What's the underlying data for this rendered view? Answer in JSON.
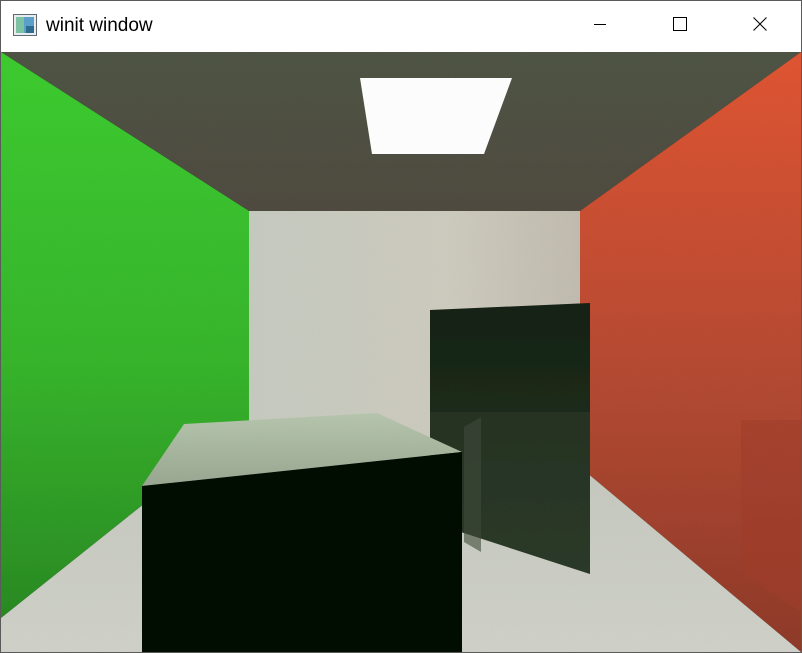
{
  "window": {
    "title": "winit window",
    "app_icon": "winit-app-icon",
    "controls": {
      "minimize_icon": "minimize-icon",
      "maximize_icon": "maximize-icon",
      "close_icon": "close-icon"
    }
  },
  "scene": {
    "description_name": "cornell-box-render",
    "colors": {
      "left_wall": "#36b52c",
      "right_wall": "#c9492a",
      "back_wall": "#c9c9bf",
      "ceiling": "#55564a",
      "floor": "#c8cac2",
      "light": "#ffffff",
      "short_box_front": "#050805",
      "short_box_top": "#a8b7a0",
      "tall_box": "#1d2a1a"
    }
  }
}
